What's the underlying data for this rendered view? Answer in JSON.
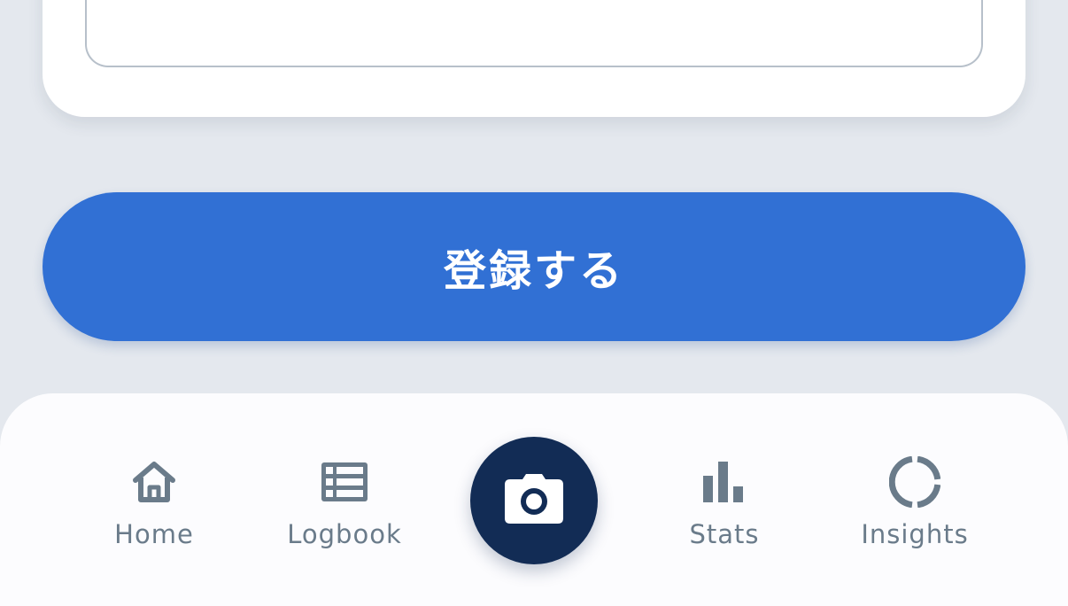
{
  "form": {
    "submit_label": "登録する"
  },
  "bottom_nav": {
    "items": [
      {
        "label": "Home",
        "icon": "home-icon"
      },
      {
        "label": "Logbook",
        "icon": "list-icon"
      },
      {
        "label": "",
        "icon": "camera-icon"
      },
      {
        "label": "Stats",
        "icon": "bar-chart-icon"
      },
      {
        "label": "Insights",
        "icon": "donut-chart-icon"
      }
    ]
  },
  "colors": {
    "background": "#e4e8ee",
    "primary": "#3170d4",
    "fab": "#122c55",
    "nav_icon": "#6a7b8a"
  }
}
